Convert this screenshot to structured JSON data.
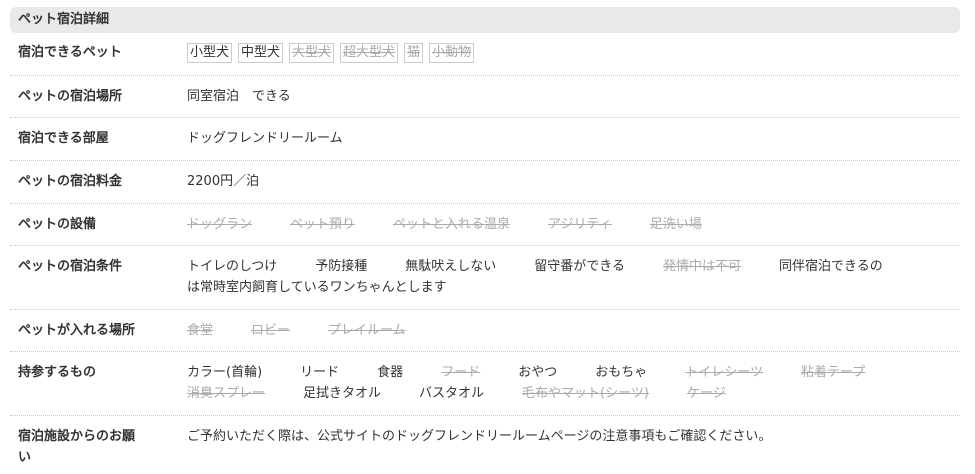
{
  "section_title": "ペット宿泊詳細",
  "rows": {
    "pets": {
      "label": "宿泊できるペット",
      "tags": [
        {
          "text": "小型犬",
          "available": true
        },
        {
          "text": "中型犬",
          "available": true
        },
        {
          "text": "大型犬",
          "available": false
        },
        {
          "text": "超大型犬",
          "available": false
        },
        {
          "text": "猫",
          "available": false
        },
        {
          "text": "小動物",
          "available": false
        }
      ]
    },
    "place": {
      "label": "ペットの宿泊場所",
      "value": "同室宿泊　できる"
    },
    "room": {
      "label": "宿泊できる部屋",
      "value": "ドッグフレンドリールーム"
    },
    "fee": {
      "label": "ペットの宿泊料金",
      "value": "2200円／泊"
    },
    "facilities": {
      "label": "ペットの設備",
      "items": [
        {
          "text": "ドッグラン",
          "available": false
        },
        {
          "text": "ペット預り",
          "available": false
        },
        {
          "text": "ペットと入れる温泉",
          "available": false
        },
        {
          "text": "アジリティ",
          "available": false
        },
        {
          "text": "足洗い場",
          "available": false
        }
      ]
    },
    "conditions": {
      "label": "ペットの宿泊条件",
      "items": [
        {
          "text": "トイレのしつけ",
          "available": true
        },
        {
          "text": "予防接種",
          "available": true
        },
        {
          "text": "無駄吠えしない",
          "available": true
        },
        {
          "text": "留守番ができる",
          "available": true
        },
        {
          "text": "発情中は不可",
          "available": false
        }
      ],
      "trailing_text_line1": "同伴宿泊できるの",
      "trailing_text_line2": "は常時室内飼育しているワンちゃんとします"
    },
    "areas": {
      "label": "ペットが入れる場所",
      "items": [
        {
          "text": "食堂",
          "available": false
        },
        {
          "text": "ロビー",
          "available": false
        },
        {
          "text": "プレイルーム",
          "available": false
        }
      ]
    },
    "bring": {
      "label": "持参するもの",
      "items": [
        {
          "text": "カラー(首輪)",
          "available": true
        },
        {
          "text": "リード",
          "available": true
        },
        {
          "text": "食器",
          "available": true
        },
        {
          "text": "フード",
          "available": false
        },
        {
          "text": "おやつ",
          "available": true
        },
        {
          "text": "おもちゃ",
          "available": true
        },
        {
          "text": "トイレシーツ",
          "available": false
        },
        {
          "text": "粘着テープ",
          "available": false
        },
        {
          "text": "消臭スプレー",
          "available": false
        },
        {
          "text": "足拭きタオル",
          "available": true
        },
        {
          "text": "バスタオル",
          "available": true
        },
        {
          "text": "毛布やマット(シーツ)",
          "available": false
        },
        {
          "text": "ケージ",
          "available": false
        }
      ]
    },
    "request": {
      "label_line1": "宿泊施設からのお願",
      "label_line2": "い",
      "value": "ご予約いただく際は、公式サイトのドッグフレンドリールームページの注意事項もご確認ください。"
    }
  }
}
